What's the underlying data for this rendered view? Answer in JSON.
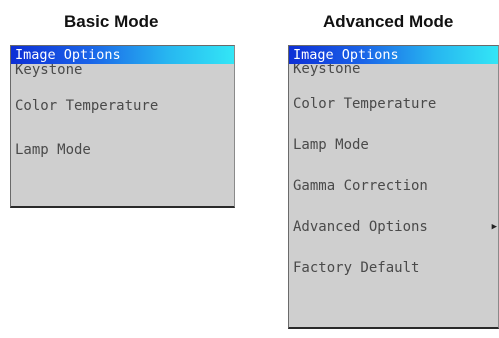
{
  "basic": {
    "title": "Basic Mode",
    "header": "Image Options",
    "items": [
      "Keystone",
      "Color Temperature",
      "Lamp Mode"
    ]
  },
  "advanced": {
    "title": "Advanced Mode",
    "header": "Image Options",
    "items": [
      "Keystone",
      "Color Temperature",
      "Lamp Mode",
      "Gamma Correction",
      "Advanced Options",
      "Factory Default"
    ],
    "submenu_arrow_icon": "triangle-right-icon"
  },
  "colors": {
    "menu_bg": "#cfcfcf",
    "header_gradient_start": "#0d2fd6",
    "header_gradient_end": "#33e6f6",
    "item_text": "#4a4a4a"
  }
}
